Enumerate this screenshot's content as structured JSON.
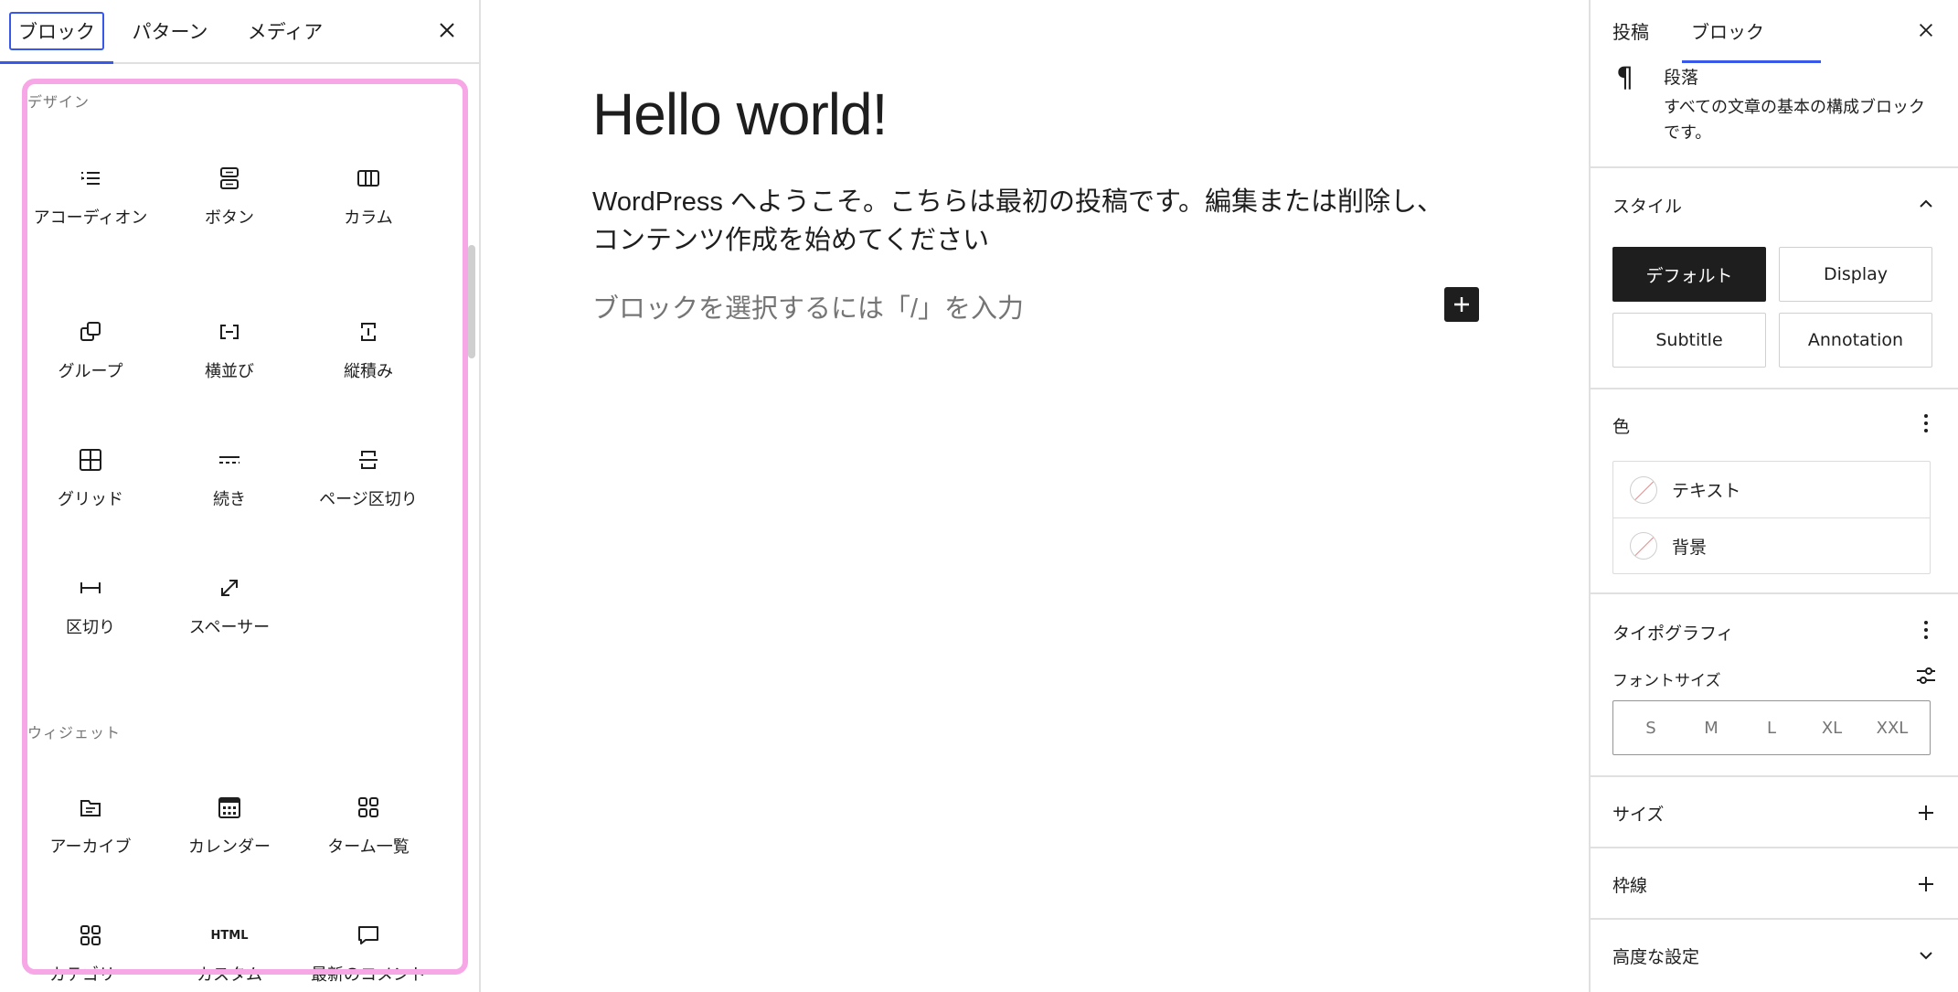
{
  "inserter": {
    "tabs": [
      "ブロック",
      "パターン",
      "メディア"
    ],
    "categories": [
      {
        "title": "デザイン",
        "blocks": [
          {
            "label": "アコーディオン",
            "icon": "accordion-icon"
          },
          {
            "label": "ボタン",
            "icon": "buttons-icon"
          },
          {
            "label": "カラム",
            "icon": "columns-icon"
          },
          {
            "label": "グループ",
            "icon": "group-icon"
          },
          {
            "label": "横並び",
            "icon": "row-icon"
          },
          {
            "label": "縦積み",
            "icon": "stack-icon"
          },
          {
            "label": "グリッド",
            "icon": "grid-icon"
          },
          {
            "label": "続き",
            "icon": "more-icon"
          },
          {
            "label": "ページ区切り",
            "icon": "page-break-icon"
          },
          {
            "label": "区切り",
            "icon": "separator-icon"
          },
          {
            "label": "スペーサー",
            "icon": "spacer-icon"
          }
        ]
      },
      {
        "title": "ウィジェット",
        "blocks": [
          {
            "label": "アーカイブ",
            "icon": "archive-icon"
          },
          {
            "label": "カレンダー",
            "icon": "calendar-icon"
          },
          {
            "label": "ターム一覧",
            "icon": "terms-list-icon"
          },
          {
            "label": "カテゴリー",
            "icon": "categories-icon"
          },
          {
            "label": "カスタム",
            "icon": "html-icon",
            "icon_text": "HTML"
          },
          {
            "label": "最新のコメント",
            "icon": "comments-icon"
          }
        ]
      }
    ]
  },
  "editor": {
    "title": "Hello world!",
    "paragraph": "WordPress へようこそ。こちらは最初の投稿です。編集または削除し、コンテンツ作成を始めてください",
    "placeholder": "ブロックを選択するには「/」を入力"
  },
  "sidebar": {
    "tabs": [
      "投稿",
      "ブロック"
    ],
    "block_card": {
      "icon": "¶",
      "title": "段落",
      "description": "すべての文章の基本の構成ブロックです。"
    },
    "styles": {
      "title": "スタイル",
      "options": [
        "デフォルト",
        "Display",
        "Subtitle",
        "Annotation"
      ],
      "selected": "デフォルト"
    },
    "color": {
      "title": "色",
      "items": [
        "テキスト",
        "背景"
      ]
    },
    "typography": {
      "title": "タイポグラフィ",
      "font_size_label": "フォントサイズ",
      "sizes": [
        "S",
        "M",
        "L",
        "XL",
        "XXL"
      ]
    },
    "size": {
      "title": "サイズ"
    },
    "border": {
      "title": "枠線"
    },
    "advanced": {
      "title": "高度な設定"
    }
  },
  "colors": {
    "accent": "#3858e9",
    "highlight": "#f7a6e6",
    "dark": "#1e1e1e"
  }
}
